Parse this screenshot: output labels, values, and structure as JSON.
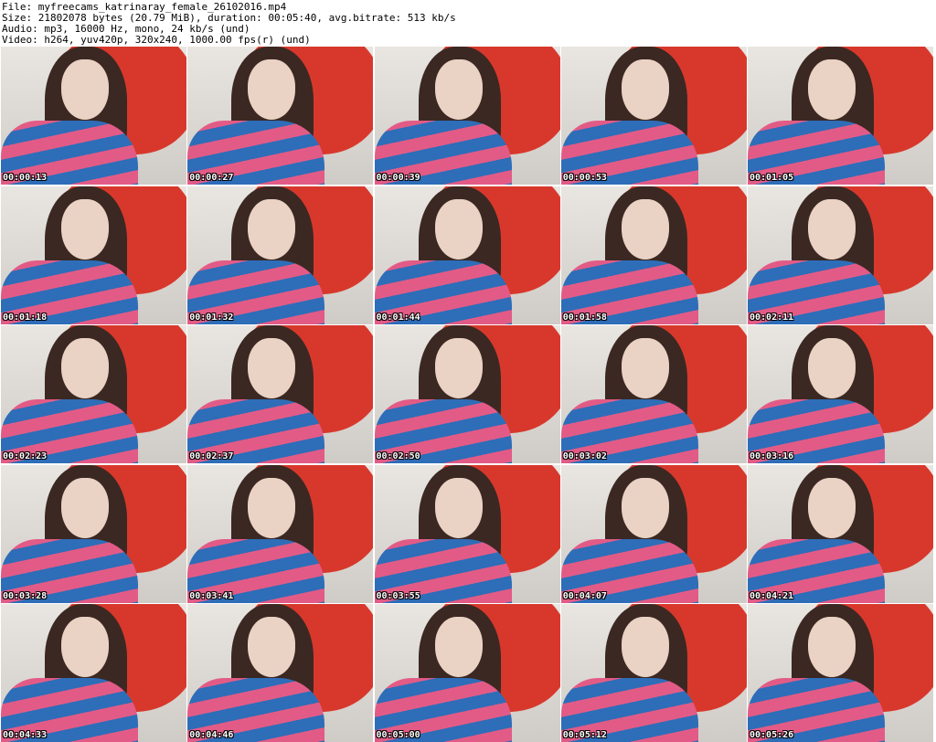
{
  "header": {
    "file_line": "File: myfreecams_katrinaray_female_26102016.mp4",
    "size_line": "Size: 21802078 bytes (20.79 MiB), duration: 00:05:40, avg.bitrate: 513 kb/s",
    "audio_line": "Audio: mp3, 16000 Hz, mono, 24 kb/s (und)",
    "video_line": "Video: h264, yuv420p, 320x240, 1000.00 fps(r) (und)"
  },
  "thumbnails": [
    {
      "timestamp": "00:00:13"
    },
    {
      "timestamp": "00:00:27"
    },
    {
      "timestamp": "00:00:39"
    },
    {
      "timestamp": "00:00:53"
    },
    {
      "timestamp": "00:01:05"
    },
    {
      "timestamp": "00:01:18"
    },
    {
      "timestamp": "00:01:32"
    },
    {
      "timestamp": "00:01:44"
    },
    {
      "timestamp": "00:01:58"
    },
    {
      "timestamp": "00:02:11"
    },
    {
      "timestamp": "00:02:23"
    },
    {
      "timestamp": "00:02:37"
    },
    {
      "timestamp": "00:02:50"
    },
    {
      "timestamp": "00:03:02"
    },
    {
      "timestamp": "00:03:16"
    },
    {
      "timestamp": "00:03:28"
    },
    {
      "timestamp": "00:03:41"
    },
    {
      "timestamp": "00:03:55"
    },
    {
      "timestamp": "00:04:07"
    },
    {
      "timestamp": "00:04:21"
    },
    {
      "timestamp": "00:04:33"
    },
    {
      "timestamp": "00:04:46"
    },
    {
      "timestamp": "00:05:00"
    },
    {
      "timestamp": "00:05:12"
    },
    {
      "timestamp": "00:05:26"
    }
  ]
}
